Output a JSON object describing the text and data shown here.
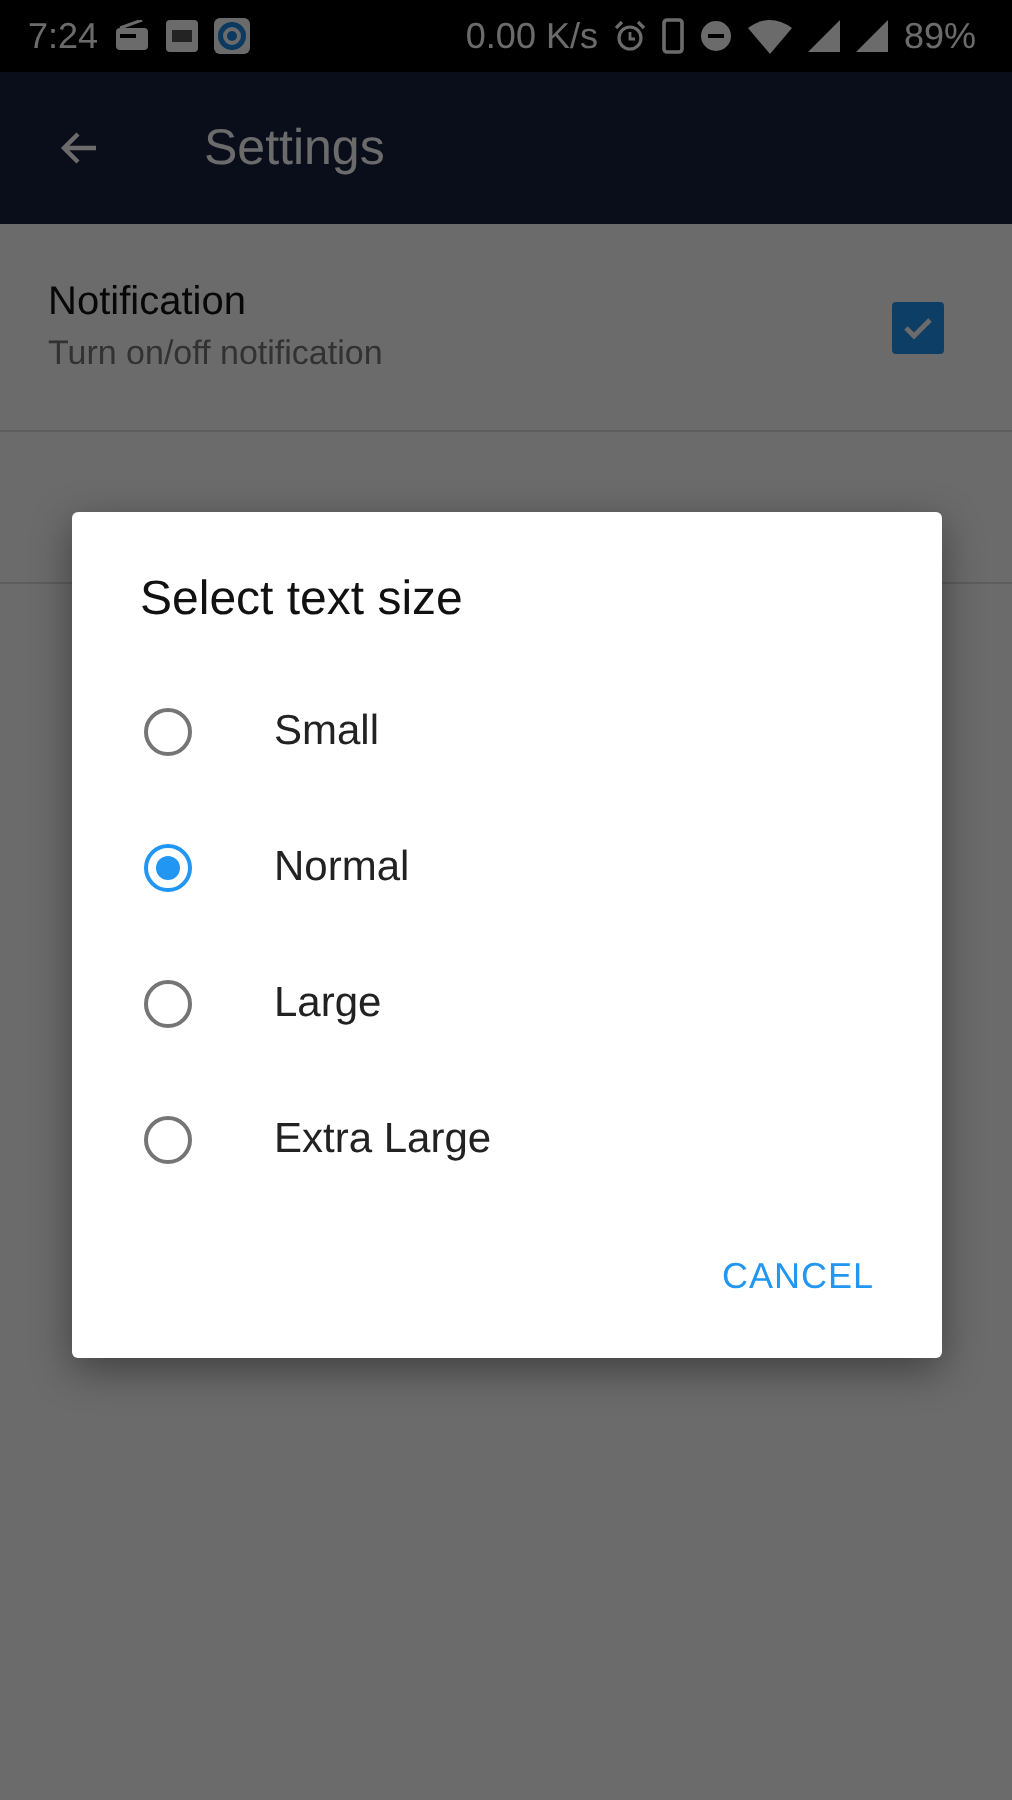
{
  "status_bar": {
    "time": "7:24",
    "speed": "0.00 K/s",
    "battery": "89%"
  },
  "app_bar": {
    "title": "Settings"
  },
  "settings": [
    {
      "kind": "checkbox",
      "title": "Notification",
      "subtitle": "Turn on/off notification",
      "checked": true
    },
    {
      "kind": "plain"
    }
  ],
  "dialog": {
    "title": "Select text size",
    "options": [
      {
        "label": "Small",
        "selected": false
      },
      {
        "label": "Normal",
        "selected": true
      },
      {
        "label": "Large",
        "selected": false
      },
      {
        "label": "Extra Large",
        "selected": false
      }
    ],
    "buttons": [
      "CANCEL"
    ]
  }
}
